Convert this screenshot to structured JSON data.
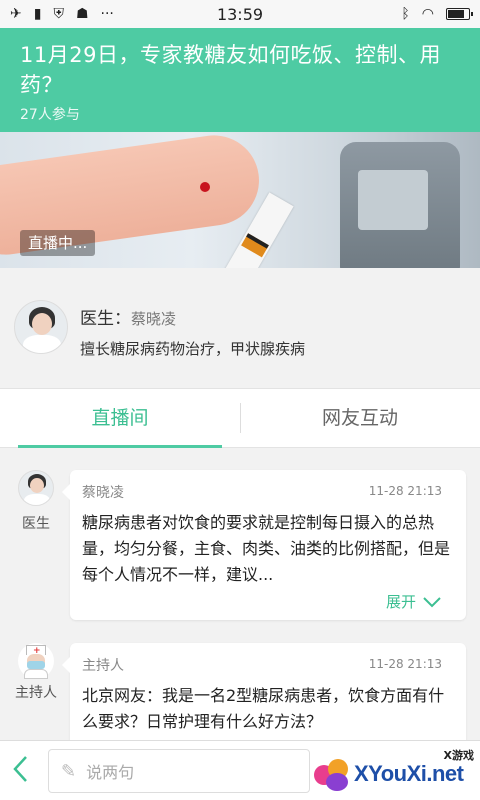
{
  "statusbar": {
    "time": "13:59",
    "left_icons": [
      "airplane-icon",
      "sim-icon",
      "shield-icon",
      "android-icon",
      "more-icon"
    ],
    "right_icons": [
      "bluetooth-icon",
      "wifi-icon",
      "battery-icon"
    ],
    "battery_level": 0.85
  },
  "header": {
    "title": "11月29日，专家教糖友如何吃饭、控制、用药？",
    "participants": "27人参与",
    "background_color": "#4ecba3"
  },
  "banner": {
    "live_badge": "直播中..."
  },
  "doctor": {
    "label": "医生：",
    "name": "蔡晓凌",
    "specialty": "擅长糖尿病药物治疗，甲状腺疾病"
  },
  "tabs": [
    {
      "label": "直播间",
      "active": true
    },
    {
      "label": "网友互动",
      "active": false
    }
  ],
  "messages": [
    {
      "role": "医生",
      "author": "蔡晓凌",
      "time": "11-28 21:13",
      "text": "糖尿病患者对饮食的要求就是控制每日摄入的总热量，均匀分餐，主食、肉类、油类的比例搭配，但是每个人情况不一样，建议...",
      "expand_label": "展开"
    },
    {
      "role": "主持人",
      "author": "主持人",
      "time": "11-28 21:13",
      "text": "北京网友：我是一名2型糖尿病患者，饮食方面有什么要求？日常护理有什么好方法？"
    }
  ],
  "bottombar": {
    "input_placeholder": "说两句",
    "watermark_small": "X游戏",
    "watermark_big": "XYouXi.net"
  },
  "accent_color": "#3cbf92"
}
